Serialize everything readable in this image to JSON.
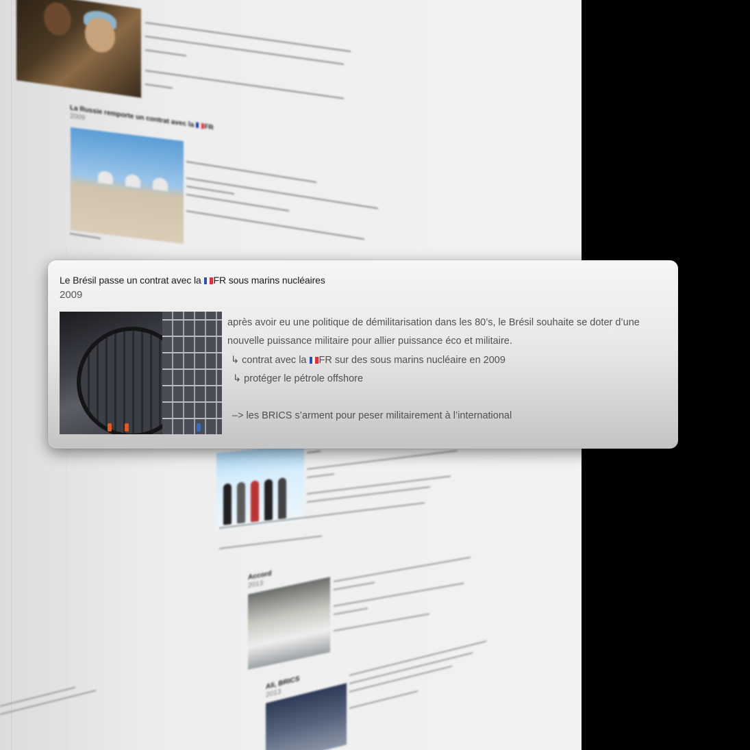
{
  "background_doc": {
    "heading_1": "La Russie remporte un contrat avec la 🇫🇷FR",
    "heading_1_year": "2009",
    "heading_2": "Accord",
    "heading_2_year": "2013",
    "heading_3": "Ali, BRICS",
    "heading_3_year": "2013"
  },
  "card": {
    "title_before_flag": "Le Brésil passe un contrat avec la ",
    "title_after_flag": "FR sous marins nucléaires",
    "year": "2009",
    "photo_icon": "submarine-construction-photo",
    "line1": "après avoir eu une politique de démilitarisation dans les 80’s, le Brésil souhaite se doter d’une",
    "line2": "nouvelle puissance militaire pour allier puissance éco et militaire.",
    "line3_before_flag": "↳ contrat avec la ",
    "line3_after_flag": "FR sur des sous marins nucléaire en 2009",
    "line4": "↳ protéger le pétrole offshore",
    "line5": "–> les BRICS s’arment pour peser militairement à l’international"
  },
  "colors": {
    "flag_blue": "#2a4fb8",
    "flag_white": "#f5f5f5",
    "flag_red": "#e0303a"
  }
}
